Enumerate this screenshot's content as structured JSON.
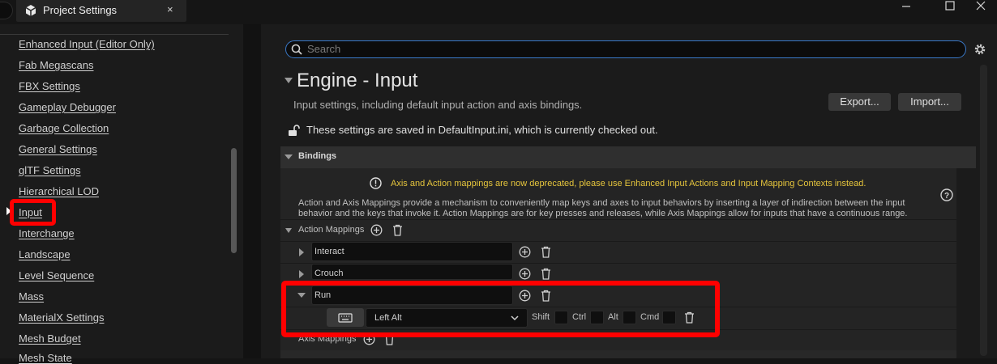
{
  "window": {
    "tab_title": "Project Settings",
    "tab_close": "×",
    "controls": {
      "minimize": "—",
      "maximize": "☐",
      "close": "✕"
    }
  },
  "sidebar": {
    "items": [
      {
        "label": "Enhanced Input (Editor Only)"
      },
      {
        "label": "Fab Megascans"
      },
      {
        "label": "FBX Settings"
      },
      {
        "label": "Gameplay Debugger"
      },
      {
        "label": "Garbage Collection"
      },
      {
        "label": "General Settings"
      },
      {
        "label": "glTF Settings"
      },
      {
        "label": "Hierarchical LOD"
      },
      {
        "label": "Input",
        "selected": true
      },
      {
        "label": "Interchange"
      },
      {
        "label": "Landscape"
      },
      {
        "label": "Level Sequence"
      },
      {
        "label": "Mass"
      },
      {
        "label": "MaterialX Settings"
      },
      {
        "label": "Mesh Budget"
      },
      {
        "label": "Mesh State"
      }
    ]
  },
  "search": {
    "placeholder": "Search"
  },
  "section": {
    "title": "Engine - Input",
    "description": "Input settings, including default input action and axis bindings.",
    "export_label": "Export...",
    "import_label": "Import...",
    "saved_notice": "These settings are saved in DefaultInput.ini, which is currently checked out."
  },
  "bindings": {
    "header": "Bindings",
    "warning": "Axis and Action mappings are now deprecated, please use Enhanced Input Actions and Input Mapping Contexts instead.",
    "help": "Action and Axis Mappings provide a mechanism to conveniently map keys and axes to input behaviors by inserting a layer of indirection between the input behavior and the keys that invoke it. Action Mappings are for key presses and releases, while Axis Mappings allow for inputs that have a continuous range.",
    "action_mappings_label": "Action Mappings",
    "actions": [
      {
        "name": "Interact"
      },
      {
        "name": "Crouch"
      },
      {
        "name": "Run",
        "expanded": true
      }
    ],
    "run_key": {
      "key": "Left Alt",
      "modifiers": [
        "Shift",
        "Ctrl",
        "Alt",
        "Cmd"
      ]
    },
    "axis_mappings_label": "Axis Mappings"
  },
  "colors": {
    "highlight": "#ff0000",
    "warning_text": "#e6c53c",
    "search_border": "#3a79c9"
  }
}
